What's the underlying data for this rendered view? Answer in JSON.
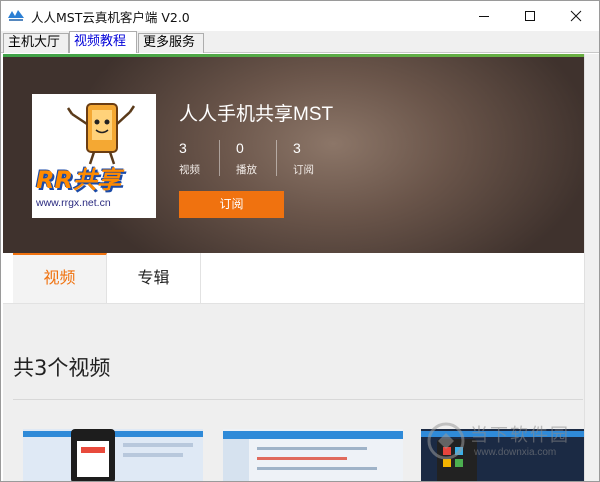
{
  "window": {
    "title": "人人MST云真机客户端 V2.0"
  },
  "tabs": [
    {
      "label": "主机大厅"
    },
    {
      "label": "视频教程"
    },
    {
      "label": "更多服务"
    }
  ],
  "channel": {
    "name": "人人手机共享MST",
    "logo_text": "RR共享",
    "logo_url": "www.rrgx.net.cn",
    "stats": [
      {
        "value": "3",
        "label": "视频"
      },
      {
        "value": "0",
        "label": "播放"
      },
      {
        "value": "3",
        "label": "订阅"
      }
    ],
    "subscribe_label": "订阅"
  },
  "content_tabs": [
    {
      "label": "视频"
    },
    {
      "label": "专辑"
    }
  ],
  "video_count_title": "共3个视频",
  "watermark": {
    "brand": "当下软件园",
    "url": "www.downxia.com"
  },
  "colors": {
    "accent": "#f0720f",
    "active_tab_text": "#0000d8"
  }
}
